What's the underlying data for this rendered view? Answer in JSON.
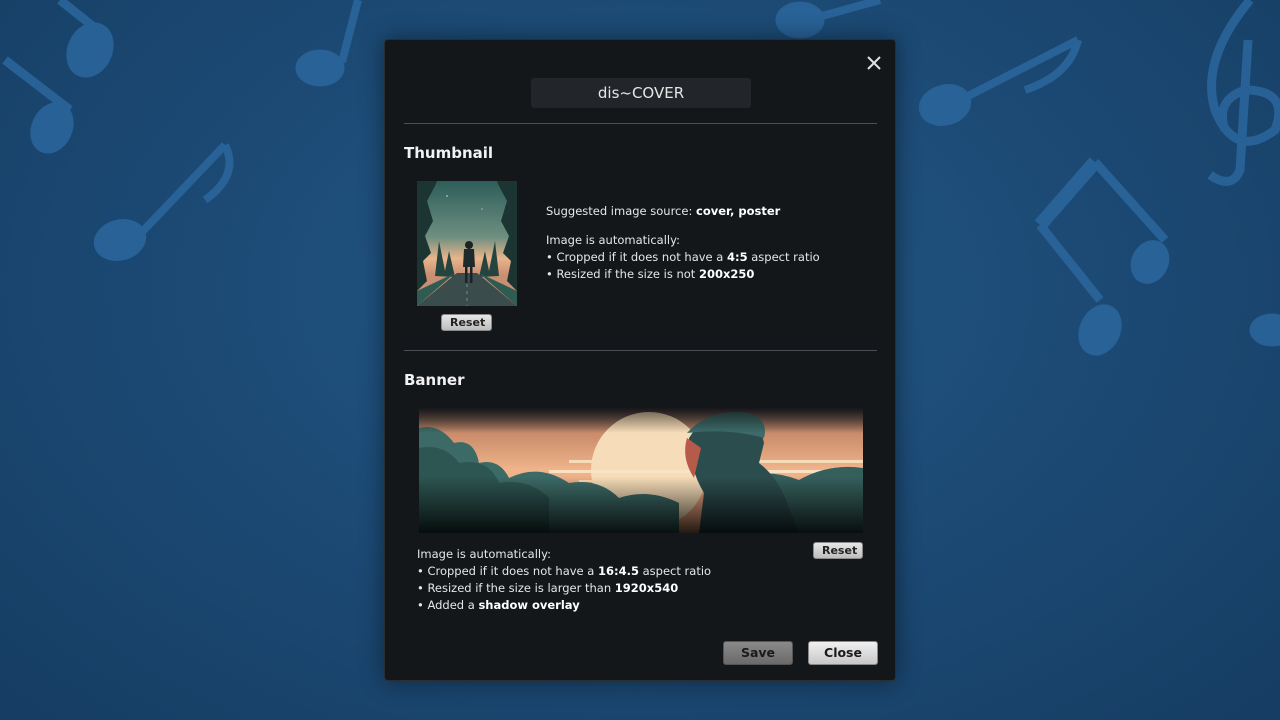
{
  "dialog": {
    "title": "dis~COVER",
    "close_icon": "close-icon"
  },
  "thumbnail": {
    "heading": "Thumbnail",
    "reset_label": "Reset",
    "source_prefix": "Suggested image source: ",
    "source_value": "cover, poster",
    "auto_intro": "Image is automatically:",
    "crop_prefix": "• Cropped if it does not have a ",
    "crop_ratio": "4:5",
    "crop_suffix": " aspect ratio",
    "resize_prefix": "• Resized if the size is not ",
    "resize_value": "200x250"
  },
  "banner": {
    "heading": "Banner",
    "reset_label": "Reset",
    "auto_intro": "Image is automatically:",
    "crop_prefix": "• Cropped if it does not have a ",
    "crop_ratio": "16:4.5",
    "crop_suffix": " aspect ratio",
    "resize_prefix": "• Resized if the size is larger than ",
    "resize_value": "1920x540",
    "overlay_prefix": "• Added a ",
    "overlay_value": "shadow overlay"
  },
  "footer": {
    "save_label": "Save",
    "close_label": "Close"
  },
  "colors": {
    "background": "#1c4b76",
    "dialog": "#14171a",
    "notes": "#2b679e"
  }
}
